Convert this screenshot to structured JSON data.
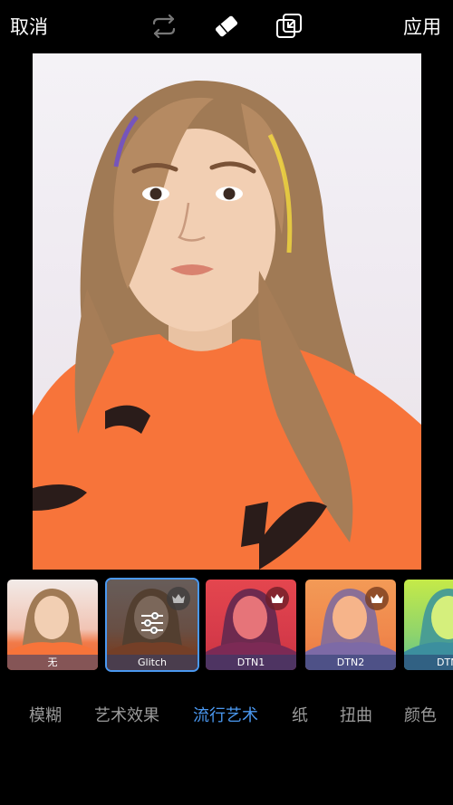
{
  "topbar": {
    "cancel_label": "取消",
    "apply_label": "应用",
    "icons": [
      "swap-icon",
      "eraser-icon",
      "compare-icon"
    ]
  },
  "filters": [
    {
      "label": "无",
      "premium": false,
      "selected": false
    },
    {
      "label": "Glitch",
      "premium": true,
      "selected": true
    },
    {
      "label": "DTN1",
      "premium": true,
      "selected": false
    },
    {
      "label": "DTN2",
      "premium": true,
      "selected": false
    },
    {
      "label": "DTN",
      "premium": false,
      "selected": false
    }
  ],
  "categories": [
    {
      "label": "模糊",
      "active": false
    },
    {
      "label": "艺术效果",
      "active": false
    },
    {
      "label": "流行艺术",
      "active": true
    },
    {
      "label": "纸",
      "active": false
    },
    {
      "label": "扭曲",
      "active": false
    },
    {
      "label": "颜色",
      "active": false
    }
  ],
  "colors": {
    "accent": "#4a98f0",
    "inactive_text": "#9b9b9b",
    "background": "#000000",
    "shirt": "#f7743a"
  }
}
